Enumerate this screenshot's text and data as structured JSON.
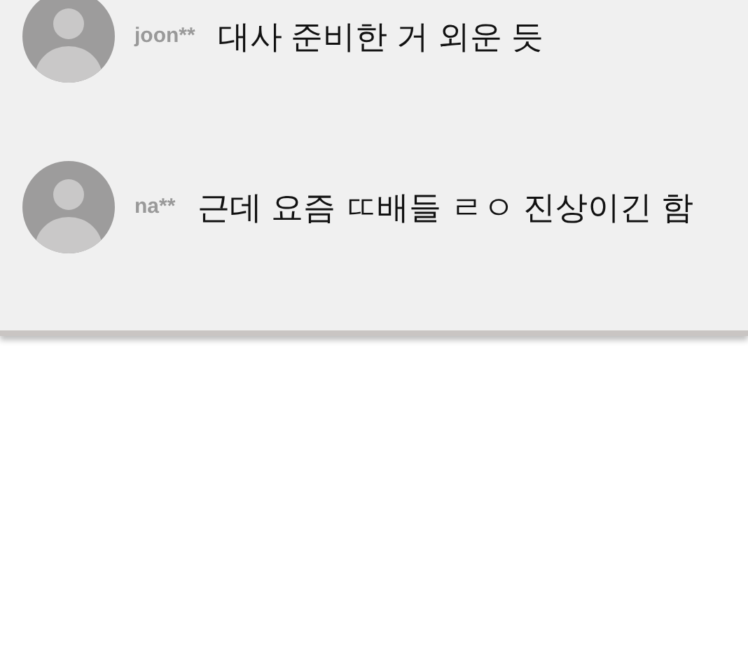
{
  "comments": [
    {
      "user": "joon**",
      "text": "대사 준비한 거 외운 듯"
    },
    {
      "user": "na**",
      "text": "근데 요즘 ㄸ배들 ㄹㅇ 진상이긴 함"
    }
  ]
}
